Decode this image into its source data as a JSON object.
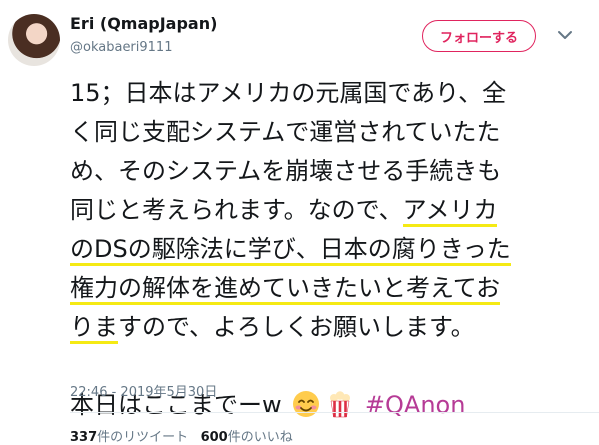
{
  "user": {
    "name": "Eri (QmapJapan)",
    "handle": "@okabaeri9111"
  },
  "follow_label": "フォローする",
  "tweet": {
    "line1": "15；日本はアメリカの元属国であり、全",
    "line2": "く同じ支配システムで運営されていたた",
    "line3": "め、そのシステムを崩壊させる手続きも",
    "line4_a": "同じと考えられます。なので、",
    "line4_b": "アメリカ",
    "line5": "のDSの駆除法に学び、日本の腐りきった",
    "line6": "権力の解体を進めていきたいと考えてお",
    "line7_a": "りま",
    "line7_b": "すので、よろしくお願いします。",
    "line8_text": "本日はここまでーw",
    "hashtag": "#QAnon"
  },
  "icons": {
    "emoji1": "smiling-face-with-hearts-icon",
    "emoji2": "popcorn-icon",
    "menu": "chevron-down-icon"
  },
  "timestamp": "22:46 - 2019年5月30日",
  "stats": {
    "retweets_count": "337",
    "retweets_label": "件のリツイート",
    "likes_count": "600",
    "likes_label": "件のいいね"
  },
  "colors": {
    "accent": "#e0245e",
    "hashtag": "#b63b96",
    "highlight": "#f5ea14",
    "muted": "#657786"
  }
}
